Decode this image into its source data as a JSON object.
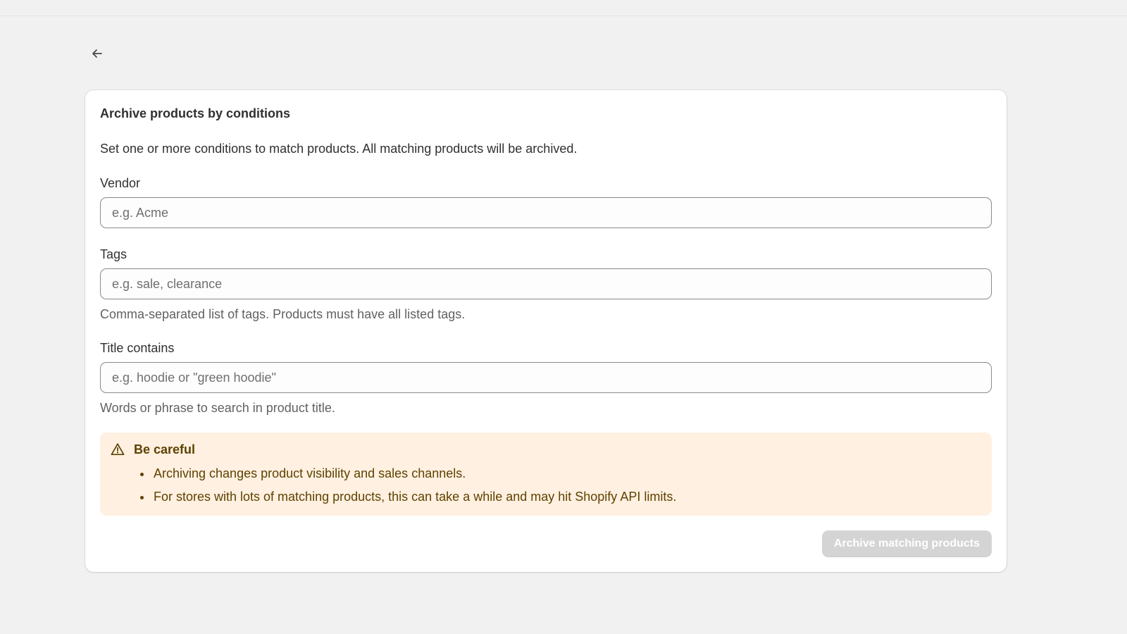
{
  "page": {
    "back_icon": "arrow-left-icon"
  },
  "card": {
    "title": "Archive products by conditions",
    "description": "Set one or more conditions to match products. All matching products will be archived."
  },
  "fields": {
    "vendor": {
      "label": "Vendor",
      "value": "",
      "placeholder": "e.g. Acme"
    },
    "tags": {
      "label": "Tags",
      "value": "",
      "placeholder": "e.g. sale, clearance",
      "help": "Comma-separated list of tags. Products must have all listed tags."
    },
    "title_contains": {
      "label": "Title contains",
      "value": "",
      "placeholder": "e.g. hoodie or \"green hoodie\"",
      "help": "Words or phrase to search in product title."
    }
  },
  "warning": {
    "icon": "alert-triangle-icon",
    "title": "Be careful",
    "items": [
      "Archiving changes product visibility and sales channels.",
      "For stores with lots of matching products, this can take a while and may hit Shopify API limits."
    ],
    "background_color": "#fff0e1",
    "text_color": "#5e4200"
  },
  "actions": {
    "submit_label": "Archive matching products",
    "submit_disabled": true,
    "submit_color": "#d4d4d4"
  },
  "colors": {
    "page_background": "#f1f1f1",
    "card_background": "#ffffff"
  }
}
